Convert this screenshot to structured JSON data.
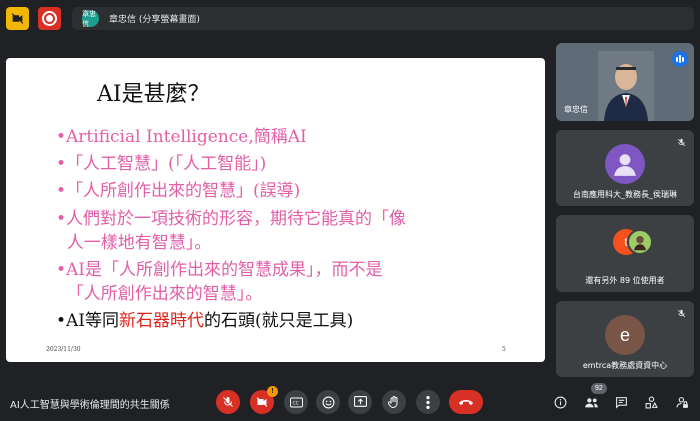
{
  "header": {
    "presenter_initials": "章忠信",
    "presenter_label": "章忠信 (分享螢幕畫面)"
  },
  "slide": {
    "title": "AI是甚麼？",
    "bullets": [
      "•Artificial Intelligence,簡稱AI",
      "•「人工智慧」(「人工智能」)",
      "•「人所創作出來的智慧」(誤導)",
      "•人們對於一項技術的形容，期待它能真的「像",
      "  人一樣地有智慧」。",
      "•AI是「人所創作出來的智慧成果」，而不是",
      "  「人所創作出來的智慧」。"
    ],
    "last_bullet": {
      "prefix": "•AI等同",
      "highlight": "新石器時代",
      "suffix": "的石頭(就只是工具)"
    },
    "date": "2023/11/30",
    "page_number": "5"
  },
  "participants": [
    {
      "name": "章忠信",
      "type": "video"
    },
    {
      "name": "台南應用科大_教務長_侯瑞琳",
      "type": "avatar",
      "initial": "",
      "color": "#7e57c2"
    },
    {
      "name": "還有另外 89 位使用者",
      "type": "others",
      "initial": "t",
      "color": "#f4511e"
    },
    {
      "name": "emtrca教務處資資中心",
      "type": "avatar",
      "initial": "e",
      "color": "#795548"
    }
  ],
  "footer": {
    "meeting_title": "AI人工智慧與學術倫理間的共生關係",
    "camera_badge": "!",
    "participant_count": "92"
  }
}
